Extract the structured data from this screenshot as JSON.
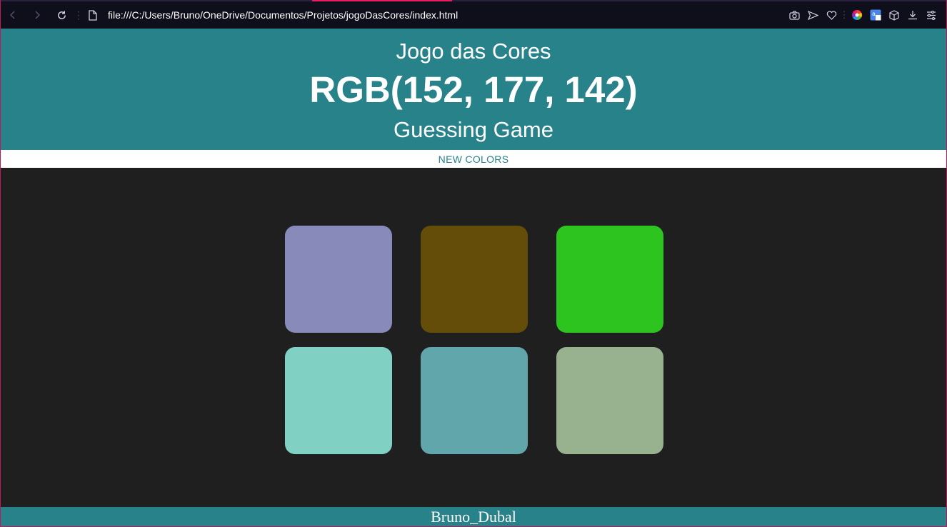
{
  "browser": {
    "url": "file:///C:/Users/Bruno/OneDrive/Documentos/Projetos/jogoDasCores/index.html",
    "icons": [
      "back-icon",
      "forward-icon",
      "reload-icon",
      "page-icon",
      "camera-icon",
      "send-icon",
      "heart-icon",
      "color-wheel-icon",
      "translate-icon",
      "cube-icon",
      "download-icon",
      "settings-sliders-icon"
    ]
  },
  "header": {
    "title": "Jogo das Cores",
    "rgb_text": "RGB(152, 177, 142)",
    "subtitle": "Guessing Game",
    "background": "#28828a"
  },
  "menu": {
    "new_colors_label": "NEW COLORS"
  },
  "squares": [
    {
      "color": "#888bba"
    },
    {
      "color": "#644d09"
    },
    {
      "color": "#2dc41f"
    },
    {
      "color": "#80d1c3"
    },
    {
      "color": "#60a6aa"
    },
    {
      "color": "#98b18e"
    }
  ],
  "footer": {
    "text": "Bruno_Dubal"
  }
}
